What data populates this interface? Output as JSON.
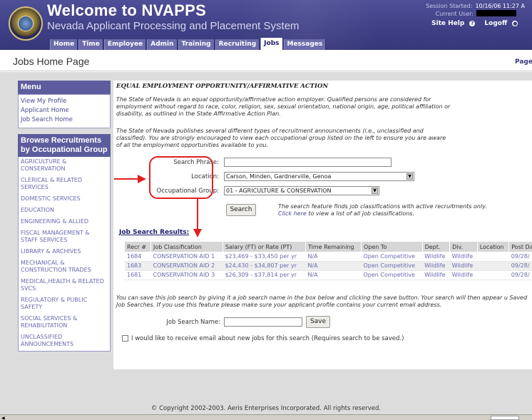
{
  "header": {
    "title": "Welcome to NVAPPS",
    "subtitle": "Nevada Applicant Processing and Placement System",
    "session_started_label": "Session Started:",
    "session_started_value": "10/16/06 11:27 A",
    "current_user_label": "Current User:",
    "site_help": "Site Help",
    "logoff": "Logoff"
  },
  "nav": {
    "tabs": [
      "Home",
      "Time",
      "Employee",
      "Admin",
      "Training",
      "Recruiting",
      "Jobs",
      "Messages"
    ],
    "active": "Jobs"
  },
  "page": {
    "title": "Jobs Home Page",
    "right_link": "Page"
  },
  "menu": {
    "heading": "Menu",
    "items": [
      "View My Profile",
      "Applicant Home",
      "Job Search Home"
    ]
  },
  "groups": {
    "heading": "Browse Recruitments by Occupational Group",
    "items": [
      "AGRICULTURE & CONSERVATION",
      "CLERICAL & RELATED SERVICES",
      "DOMESTIC SERVICES",
      "EDUCATION",
      "ENGINEERING & ALLIED",
      "FISCAL MANAGEMENT & STAFF SERVICES",
      "LIBRARY & ARCHIVES",
      "MECHANICAL & CONSTRUCTION TRADES",
      "MEDICAL,HEALTH & RELATED SVCS",
      "REGULATORY & PUBLIC SAFETY",
      "SOCIAL SERVICES & REHABILITATION",
      "UNCLASSIFIED ANNOUNCEMENTS"
    ]
  },
  "eeo": {
    "title": "EQUAL EMPLOYMENT OPPORTUNITY/AFFIRMATIVE ACTION",
    "para1": "The State of Nevada is an equal opportunity/affirmative action employer. Qualified persons are considered for employment without regard to race, color, religion, sex, sexual orientation, national origin, age, political affiliation or disability, as outlined in the State Affirmative Action Plan.",
    "para2": "The State of Nevada publishes several different types of recruitment announcements (i.e., unclassified and classified). You are strongly encouraged to view each occupational group listed on the left to ensure you are aware of all the employment opportunities available to you."
  },
  "search": {
    "phrase_label": "Search Phrase:",
    "phrase_value": "",
    "location_label": "Location:",
    "location_value": "Carson, Minden, Gardnerville, Genoa",
    "group_label": "Occupational Group:",
    "group_value": "01 - AGRICULTURE & CONSERVATION",
    "button": "Search",
    "note_part1": "The search feature finds job classifications with active recruitments only.",
    "note_link": "Click here",
    "note_part2": "to view a list of all job classifications."
  },
  "results": {
    "title": "Job Search Results:",
    "columns": [
      "Recr #",
      "Job Classification",
      "Salary (FT) or Rate (PT)",
      "Time Remaining",
      "Open To",
      "Dept.",
      "Div.",
      "Location",
      "Post Da"
    ],
    "rows": [
      [
        "1684",
        "CONSERVATION AID 1",
        "$23,469 - $33,450 per yr",
        "N/A",
        "Open Competitive",
        "Wildlife",
        "Wildlife",
        "",
        "09/28/"
      ],
      [
        "1683",
        "CONSERVATION AID 2",
        "$24,430 - $34,807 per yr",
        "N/A",
        "Open Competitive",
        "Wildlife",
        "Wildlife",
        "",
        "09/28/"
      ],
      [
        "1681",
        "CONSERVATION AID 3",
        "$26,309 - $37,814 per yr",
        "N/A",
        "Open Competitive",
        "Wildlife",
        "Wildlife",
        "",
        "09/28/"
      ]
    ]
  },
  "save": {
    "text": "You can save this job search by giving it a job search name in the box below and clicking the save button. Your search will then appear u Saved Job Searches. If you use this feature please make sure your applicant profile contains your current email address.",
    "name_label": "Job Search Name:",
    "name_value": "",
    "button": "Save",
    "email_checkbox": "I would like to receive email about new jobs for this search (Requires search to be saved.)"
  },
  "footer": "© Copyright 2002-2003. Aeris Enterprises Incorporated. All rights reserved.",
  "colors": {
    "header_bg": "#3f3f86",
    "sidebar_head": "#5d5d9d",
    "link": "#6a6ab0",
    "callout_red": "#e0201e"
  }
}
